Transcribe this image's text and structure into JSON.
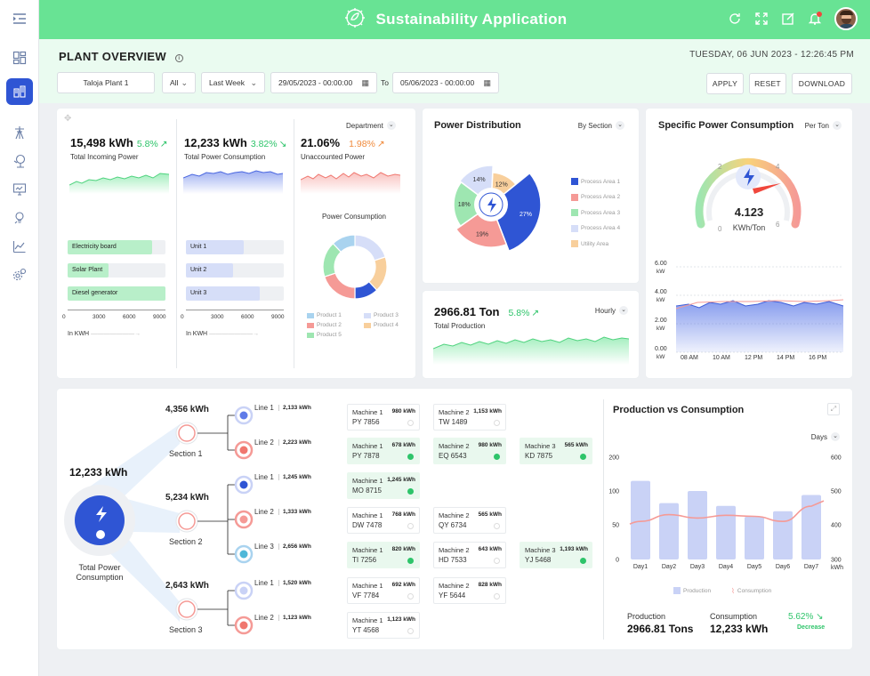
{
  "app": {
    "title": "Sustainability Application"
  },
  "sidebar": {
    "items": [
      "menu-toggle",
      "dashboard",
      "plant-overview",
      "tower",
      "tree-energy",
      "monitor",
      "lightbulb",
      "chart",
      "gear"
    ]
  },
  "header": {
    "title": "PLANT OVERVIEW",
    "datetime": "TUESDAY, 06 JUN 2023 - 12:26:45 PM",
    "plant": "Taloja Plant 1",
    "scope": "All",
    "period": "Last Week",
    "date_from": "29/05/2023 - 00:00:00",
    "to_label": "To",
    "date_to": "05/06/2023 - 00:00:00",
    "apply": "APPLY",
    "reset": "RESET",
    "download": "DOWNLOAD"
  },
  "kpis": {
    "incoming": {
      "value": "15,498 kWh",
      "pct": "5.8%",
      "arrow": "↗",
      "label": "Total Incoming Power"
    },
    "consumption": {
      "value": "12,233 kWh",
      "pct": "3.82%",
      "arrow": "↘",
      "label": "Total Power Consumption"
    },
    "unaccounted": {
      "value": "21.06%",
      "pct": "1.98%",
      "arrow": "↗",
      "label": "Unaccounted Power"
    },
    "department": "Department"
  },
  "incoming_bars": {
    "items": [
      {
        "label": "Electricity board",
        "value": 8200
      },
      {
        "label": "Solar Plant",
        "value": 4000
      },
      {
        "label": "Diesel generator",
        "value": 9500
      }
    ],
    "ticks": [
      "0",
      "3000",
      "6000",
      "9000"
    ],
    "unit": "In KWH"
  },
  "unit_bars": {
    "items": [
      {
        "label": "Unit 1",
        "value": 5600
      },
      {
        "label": "Unit 2",
        "value": 4600
      },
      {
        "label": "Unit 3",
        "value": 7200
      }
    ],
    "ticks": [
      "0",
      "3000",
      "6000",
      "9000"
    ],
    "unit": "In KWH"
  },
  "power_consumption": {
    "title": "Power Consumption",
    "legend": [
      "Product 1",
      "Product 2",
      "Product 5",
      "Product 3",
      "Product 4"
    ],
    "colors": [
      "#a9d3ef",
      "#f59a96",
      "#9ee6b1",
      "#d6def8",
      "#f8cf9c"
    ]
  },
  "power_distribution": {
    "title": "Power Distribution",
    "filter": "By Section",
    "slices": [
      {
        "label": "Process Area 1",
        "pct": 27,
        "color": "#2f55d4"
      },
      {
        "label": "Process Area 2",
        "pct": 19,
        "color": "#f59a96"
      },
      {
        "label": "Process Area 3",
        "pct": 18,
        "color": "#9ee6b1"
      },
      {
        "label": "Process Area 4",
        "pct": 14,
        "color": "#d6def8"
      },
      {
        "label": "Utility Area",
        "pct": 12,
        "color": "#f8cf9c"
      }
    ],
    "slice_labels": [
      "27%",
      "19%",
      "18%",
      "14%",
      "12%"
    ]
  },
  "production": {
    "value": "2966.81 Ton",
    "pct": "5.8%",
    "arrow": "↗",
    "label": "Total Production",
    "filter": "Hourly"
  },
  "spc": {
    "title": "Specific Power Consumption",
    "filter": "Per Ton",
    "value": "4.123",
    "unit": "KWh/Ton",
    "gauge_ticks": [
      "0",
      "2",
      "4",
      "6"
    ],
    "chart_yticks": [
      "6.00",
      "4.00",
      "2.00",
      "0.00"
    ],
    "chart_ylabel": "kW",
    "chart_xticks": [
      "08 AM",
      "10 AM",
      "12 PM",
      "14 PM",
      "16 PM"
    ]
  },
  "flow": {
    "total_value": "12,233 kWh",
    "total_label": "Total Power Consumption",
    "sections": [
      {
        "kwh": "4,356 kWh",
        "label": "Section 1"
      },
      {
        "kwh": "5,234 kWh",
        "label": "Section 2"
      },
      {
        "kwh": "2,643 kWh",
        "label": "Section 3"
      }
    ],
    "lines": [
      {
        "name": "Line 1",
        "kwh": "2,133 kWh"
      },
      {
        "name": "Line 2",
        "kwh": "2,223 kWh"
      },
      {
        "name": "Line 1",
        "kwh": "1,245 kWh"
      },
      {
        "name": "Line 2",
        "kwh": "1,333 kWh"
      },
      {
        "name": "Line 3",
        "kwh": "2,656 kWh"
      },
      {
        "name": "Line 1",
        "kwh": "1,520 kWh"
      },
      {
        "name": "Line 2",
        "kwh": "1,123 kWh"
      }
    ],
    "machines": [
      {
        "name": "Machine 1",
        "id": "PY 7856",
        "kwh": "980 kWh",
        "on": false
      },
      {
        "name": "Machine 2",
        "id": "TW 1489",
        "kwh": "1,153 kWh",
        "on": false
      },
      {
        "name": "Machine 1",
        "id": "PY 7878",
        "kwh": "678 kWh",
        "on": true
      },
      {
        "name": "Machine 2",
        "id": "EQ 6543",
        "kwh": "980 kWh",
        "on": true
      },
      {
        "name": "Machine 3",
        "id": "KD 7875",
        "kwh": "565 kWh",
        "on": true
      },
      {
        "name": "Machine 1",
        "id": "MO 8715",
        "kwh": "1,245 kWh",
        "on": true
      },
      {
        "name": "Machine 1",
        "id": "DW 7478",
        "kwh": "768 kWh",
        "on": false
      },
      {
        "name": "Machine 2",
        "id": "QY 6734",
        "kwh": "565 kWh",
        "on": false
      },
      {
        "name": "Machine 1",
        "id": "TI 7256",
        "kwh": "820 kWh",
        "on": true
      },
      {
        "name": "Machine 2",
        "id": "HD 7533",
        "kwh": "643 kWh",
        "on": false
      },
      {
        "name": "Machine 3",
        "id": "YJ 5468",
        "kwh": "1,193 kWh",
        "on": true
      },
      {
        "name": "Machine 1",
        "id": "VF 7784",
        "kwh": "692 kWh",
        "on": false
      },
      {
        "name": "Machine 2",
        "id": "YF 5644",
        "kwh": "828 kWh",
        "on": false
      },
      {
        "name": "Machine 1",
        "id": "YT 4568",
        "kwh": "1,123 kWh",
        "on": false
      }
    ]
  },
  "pvc": {
    "title": "Production vs Consumption",
    "filter": "Days",
    "production_label": "Production",
    "production_value": "2966.81 Tons",
    "consumption_label": "Consumption",
    "consumption_value": "12,233 kWh",
    "change_pct": "5.62%",
    "change_arrow": "↘",
    "change_label": "Decrease",
    "legend": [
      "Production",
      "Consumption"
    ]
  },
  "chart_data": {
    "type": "bar",
    "categories": [
      "Day1",
      "Day2",
      "Day3",
      "Day4",
      "Day5",
      "Day6",
      "Day7"
    ],
    "series": [
      {
        "name": "Production",
        "type": "bar",
        "axis": "left",
        "values": [
          130,
          82,
          100,
          78,
          62,
          70,
          94
        ]
      },
      {
        "name": "Consumption",
        "type": "line",
        "axis": "right",
        "values": [
          410,
          430,
          420,
          428,
          425,
          410,
          455
        ]
      }
    ],
    "left_ticks": [
      "200",
      "100",
      "50",
      "0"
    ],
    "right_ticks": [
      "600",
      "500",
      "400",
      "300"
    ],
    "right_unit": "kWh",
    "ylim_left": [
      0,
      200
    ],
    "ylim_right": [
      300,
      600
    ],
    "colors": {
      "bar": "#c9d2f6",
      "line": "#f59a96"
    }
  }
}
